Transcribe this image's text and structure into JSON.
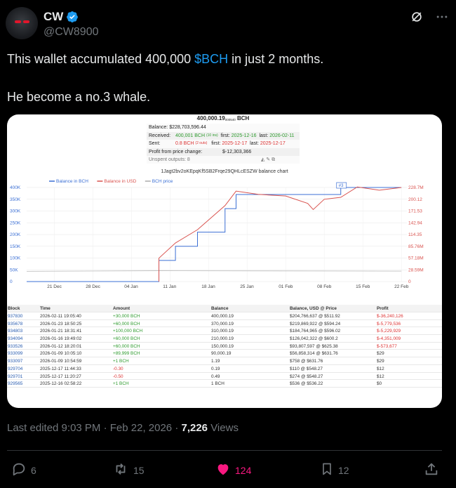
{
  "author": {
    "name": "CW",
    "handle": "@CW8900"
  },
  "tweet": {
    "line1_before": "This wallet accumulated 400,000 ",
    "cashtag": "$BCH",
    "line1_after": " in just 2 months.",
    "line2": "He become a no.3 whale."
  },
  "wallet_info": {
    "balance_bch": "400,000.19",
    "balance_bch_small": "000540",
    "balance_unit": "BCH",
    "balance_usd_label": "Balance:",
    "balance_usd": "$228,703,596.44",
    "received_label": "Received:",
    "received_value": "400,001 BCH",
    "received_count": "(10 ins)",
    "received_first_label": "first:",
    "received_first": "2025-12-16",
    "received_last_label": "last:",
    "received_last": "2026-02-11",
    "sent_label": "Sent:",
    "sent_value": "0.8 BCH",
    "sent_count": "(2 outs)",
    "sent_first_label": "first:",
    "sent_first": "2025-12-17",
    "sent_last_label": "last:",
    "sent_last": "2025-12-17",
    "profit_label": "Profit from price change:",
    "profit_value": "$-12,303,366",
    "unspent_label": "Unspent outputs: 8"
  },
  "chart_data": {
    "type": "line",
    "title": "1Jagt2bv2oKEpqKf5SB2Frqe29QHLcESZW balance chart",
    "legend": [
      "Balance in BCH",
      "Balance in USD",
      "BCH price"
    ],
    "legend_colors": [
      "#3b6fd4",
      "#d9534f",
      "#aaaaaa"
    ],
    "x_ticks": [
      "21 Dec",
      "28 Dec",
      "04 Jan",
      "11 Jan",
      "18 Jan",
      "25 Jan",
      "01 Feb",
      "08 Feb",
      "15 Feb",
      "22 Feb"
    ],
    "y_left_ticks": [
      "400K",
      "350K",
      "300K",
      "250K",
      "200K",
      "150K",
      "100K",
      "50K",
      "0"
    ],
    "y_right_ticks": [
      "228.7M",
      "200.12",
      "171.53",
      "142.94",
      "114.35",
      "85.76M",
      "57.18M",
      "28.59M",
      "0"
    ],
    "ylim_left": [
      0,
      400000
    ],
    "ylim_right": [
      0,
      228700000
    ],
    "marker_label": "#3",
    "series": [
      {
        "name": "Balance in BCH",
        "x": [
          "2025-12-16",
          "2026-01-09",
          "2026-01-09",
          "2026-01-12",
          "2026-01-16",
          "2026-01-21",
          "2026-01-23",
          "2026-02-11",
          "2026-02-22"
        ],
        "values": [
          1,
          1,
          90000,
          150000,
          210000,
          310000,
          370000,
          400000,
          400000
        ]
      },
      {
        "name": "Balance in USD",
        "x": [
          "2026-01-09",
          "2026-01-12",
          "2026-01-16",
          "2026-01-21",
          "2026-01-23",
          "2026-01-27",
          "2026-02-01",
          "2026-02-05",
          "2026-02-06",
          "2026-02-08",
          "2026-02-11",
          "2026-02-14",
          "2026-02-18",
          "2026-02-22"
        ],
        "values": [
          56858314,
          93807597,
          126042322,
          184764965,
          219869922,
          212000000,
          208000000,
          190000000,
          175000000,
          200000000,
          204766637,
          230000000,
          222000000,
          228703596
        ]
      },
      {
        "name": "BCH price",
        "x": [
          "2025-12-16",
          "2026-01-09",
          "2026-02-22"
        ],
        "values": [
          536,
          632,
          572
        ]
      }
    ]
  },
  "table": {
    "headers": [
      "Block",
      "Time",
      "Amount",
      "Balance",
      "Balance, USD @ Price",
      "Profit"
    ],
    "rows": [
      [
        "937830",
        "2026-02-11 19:05:40",
        "+30,000 BCH",
        "400,000.19",
        "$204,766,637 @ $511.92",
        "$-36,240,126"
      ],
      [
        "935678",
        "2026-01-23 18:50:25",
        "+60,000 BCH",
        "370,000.19",
        "$219,869,922 @ $594.24",
        "$-5,779,536"
      ],
      [
        "934803",
        "2026-01-21 18:31:41",
        "+100,000 BCH",
        "310,000.19",
        "$184,764,965 @ $596.02",
        "$-5,229,929"
      ],
      [
        "934094",
        "2026-01-16 19:49:02",
        "+60,000 BCH",
        "210,000.19",
        "$126,042,322 @ $600.2",
        "$-4,351,009"
      ],
      [
        "933526",
        "2026-01-12 18:20:01",
        "+60,000 BCH",
        "150,000.19",
        "$93,807,597 @ $625.38",
        "$-573,677"
      ],
      [
        "933099",
        "2026-01-09 10:05:10",
        "+89,999 BCH",
        "90,000.19",
        "$56,858,314 @ $631.76",
        "$29"
      ],
      [
        "933097",
        "2026-01-09 10:54:59",
        "+1 BCH",
        "1.19",
        "$758 @ $631.76",
        "$29"
      ],
      [
        "929704",
        "2025-12-17 11:44:33",
        "-0.30",
        "0.19",
        "$110 @ $548.27",
        "$12"
      ],
      [
        "929701",
        "2025-12-17 11:20:27",
        "-0.50",
        "0.49",
        "$274 @ $548.27",
        "$12"
      ],
      [
        "929565",
        "2025-12-16 02:58:22",
        "+1 BCH",
        "1 BCH",
        "$536 @ $536.22",
        "$0"
      ]
    ]
  },
  "meta": {
    "edited": "Last edited 9:03 PM · Feb 22, 2026 · ",
    "views_count": "7,226",
    "views_label": " Views"
  },
  "actions": {
    "replies": "6",
    "reposts": "15",
    "likes": "124",
    "bookmarks": "12"
  }
}
